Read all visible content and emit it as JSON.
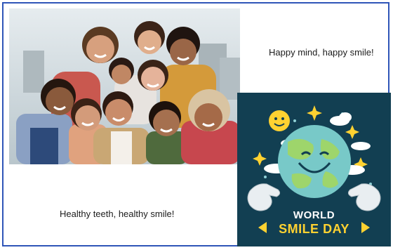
{
  "captions": {
    "top_right": "Happy mind, happy smile!",
    "bottom_left": "Healthy teeth, healthy smile!"
  },
  "poster": {
    "line1": "WORLD",
    "line2": "SMILE DAY",
    "colors": {
      "background": "#123f52",
      "accent": "#ffd231",
      "globe": "#78c9c8"
    }
  },
  "colors": {
    "border": "#2f55b8"
  }
}
